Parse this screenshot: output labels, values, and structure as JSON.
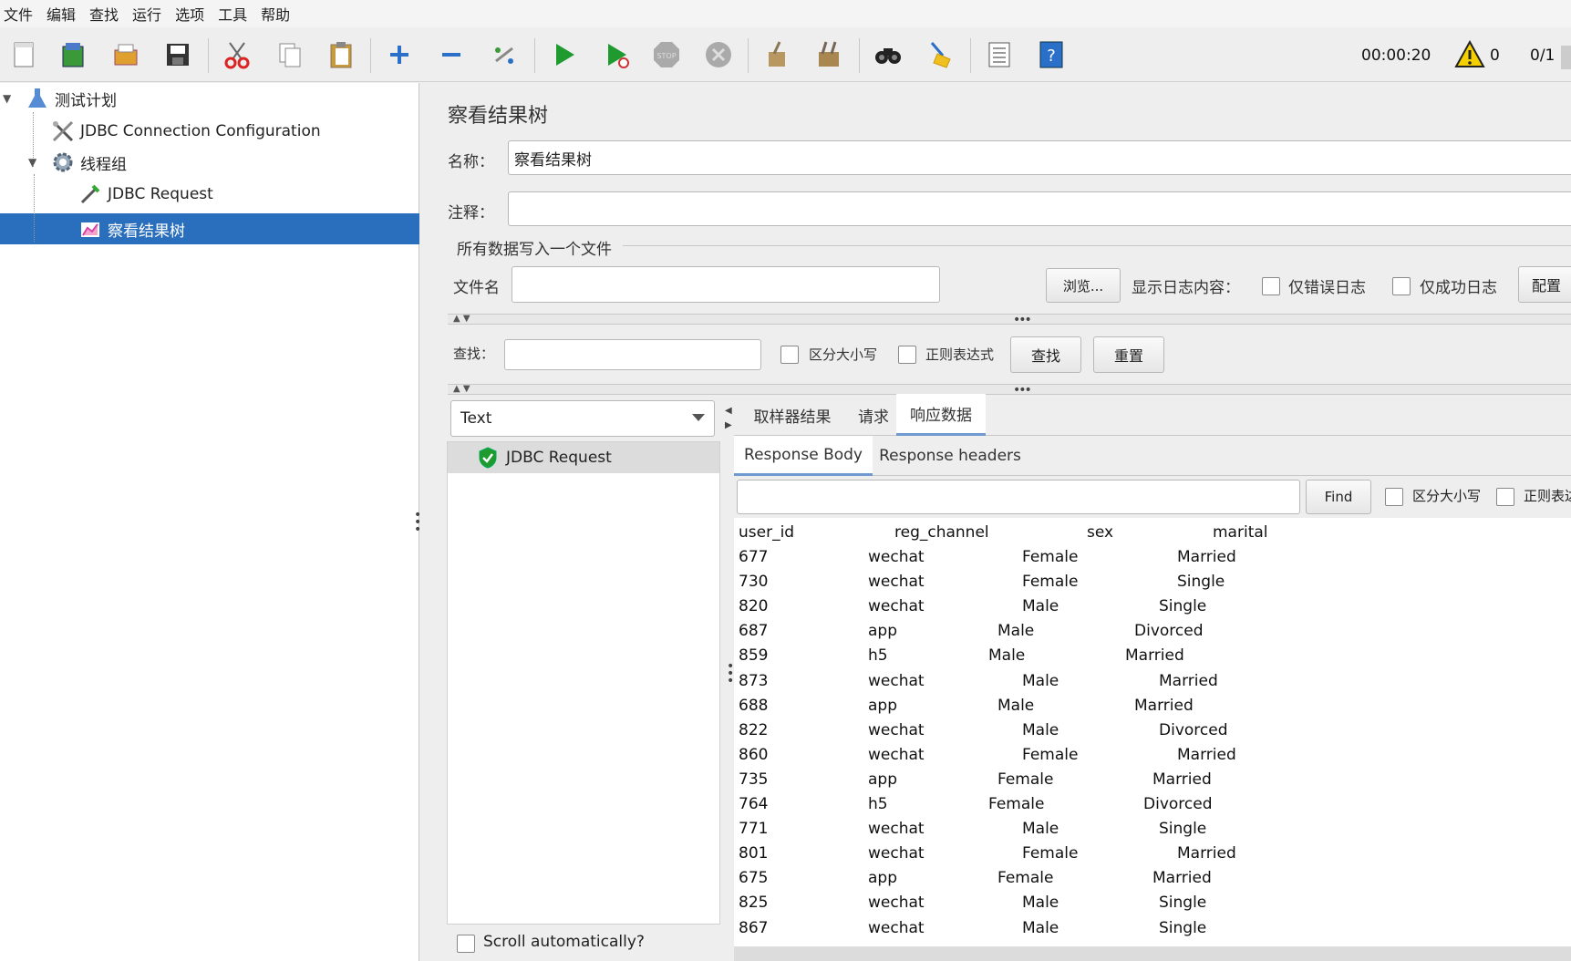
{
  "menu": [
    "文件",
    "编辑",
    "查找",
    "运行",
    "选项",
    "工具",
    "帮助"
  ],
  "toolbar": {
    "icons": [
      "new-icon",
      "templates-icon",
      "open-icon",
      "save-icon",
      "cut-icon",
      "copy-icon",
      "paste-icon",
      "expand-icon",
      "collapse-icon",
      "toggle-icon",
      "start-icon",
      "start-no-pause-icon",
      "stop-icon",
      "shutdown-icon",
      "clear-icon",
      "clear-all-icon",
      "search-icon",
      "reset-search-icon",
      "function-helper-icon",
      "help-icon"
    ],
    "timer": "00:00:20",
    "warnings": "0",
    "threads": "0/1"
  },
  "tree": {
    "nodes": [
      {
        "label": "测试计划"
      },
      {
        "label": "JDBC Connection Configuration"
      },
      {
        "label": "线程组"
      },
      {
        "label": "JDBC Request"
      },
      {
        "label": "察看结果树"
      }
    ]
  },
  "panel": {
    "title": "察看结果树",
    "name_label": "名称：",
    "name_value": "察看结果树",
    "comment_label": "注释：",
    "comment_value": "",
    "file_group_title": "所有数据写入一个文件",
    "filename_label": "文件名",
    "browse_button": "浏览...",
    "log_content_label": "显示日志内容：",
    "errors_only": "仅错误日志",
    "success_only": "仅成功日志",
    "config_button": "配置",
    "search_label": "查找：",
    "case_sensitive": "区分大小写",
    "regex": "正则表达式",
    "find_button": "查找",
    "reset_button": "重置"
  },
  "renderer": {
    "selected": "Text"
  },
  "results": {
    "items": [
      "JDBC Request"
    ],
    "scroll_auto": "Scroll automatically?"
  },
  "tabs": {
    "main": [
      "取样器结果",
      "请求",
      "响应数据"
    ],
    "sub": [
      "Response Body",
      "Response headers"
    ]
  },
  "response": {
    "find_button": "Find",
    "case_sensitive": "区分大小写",
    "regex": "正则表达"
  },
  "table": {
    "headers": [
      "user_id",
      "reg_channel",
      "sex",
      "marital"
    ],
    "rows": [
      [
        "677",
        "wechat",
        "Female",
        "Married"
      ],
      [
        "730",
        "wechat",
        "Female",
        "Single"
      ],
      [
        "820",
        "wechat",
        "Male",
        "Single"
      ],
      [
        "687",
        "app",
        "Male",
        "Divorced"
      ],
      [
        "859",
        "h5",
        "Male",
        "Married"
      ],
      [
        "873",
        "wechat",
        "Male",
        "Married"
      ],
      [
        "688",
        "app",
        "Male",
        "Married"
      ],
      [
        "822",
        "wechat",
        "Male",
        "Divorced"
      ],
      [
        "860",
        "wechat",
        "Female",
        "Married"
      ],
      [
        "735",
        "app",
        "Female",
        "Married"
      ],
      [
        "764",
        "h5",
        "Female",
        "Divorced"
      ],
      [
        "771",
        "wechat",
        "Male",
        "Single"
      ],
      [
        "801",
        "wechat",
        "Female",
        "Married"
      ],
      [
        "675",
        "app",
        "Female",
        "Married"
      ],
      [
        "825",
        "wechat",
        "Male",
        "Single"
      ],
      [
        "867",
        "wechat",
        "Male",
        "Single"
      ]
    ]
  }
}
